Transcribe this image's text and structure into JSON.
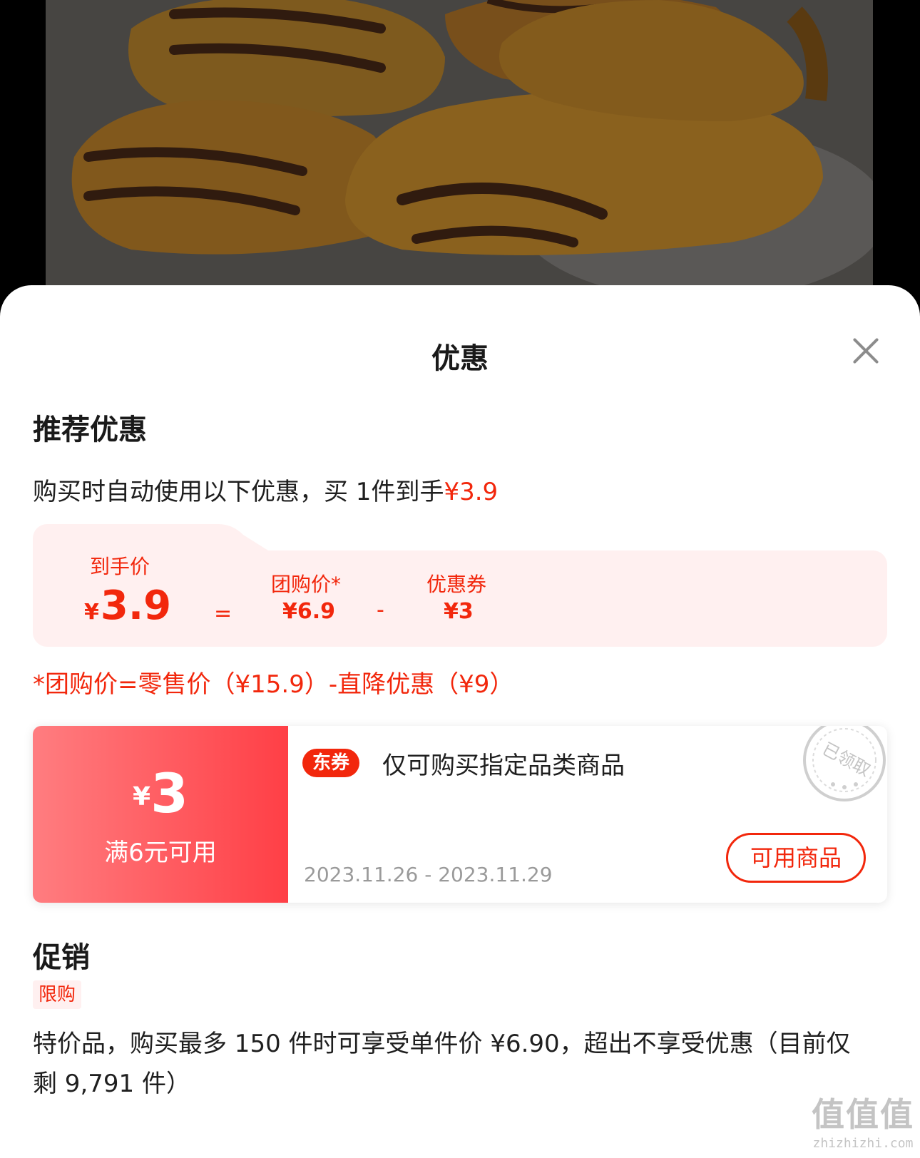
{
  "sheet": {
    "title": "优惠"
  },
  "recommended": {
    "title": "推荐优惠",
    "intro_prefix": "购买时自动使用以下优惠，买 1件到手",
    "intro_price": "¥3.9"
  },
  "breakdown": {
    "final_label": "到手价",
    "final_yen": "¥",
    "final_value": "3.9",
    "equals": "=",
    "group_label": "团购价*",
    "group_value": "¥6.9",
    "minus": "-",
    "coupon_label": "优惠券",
    "coupon_value": "¥3",
    "formula": "*团购价=零售价（¥15.9）-直降优惠（¥9）"
  },
  "coupon": {
    "yen": "¥",
    "amount": "3",
    "condition": "满6元可用",
    "badge": "东券",
    "description": "仅可购买指定品类商品",
    "date_range": "2023.11.26 - 2023.11.29",
    "button_label": "可用商品",
    "stamp_text": "已领取"
  },
  "promotion": {
    "title": "促销",
    "tag": "限购",
    "text": "特价品，购买最多 150 件时可享受单件价 ¥6.90，超出不享受优惠（目前仅剩 9,791 件）"
  },
  "watermark": {
    "main": "值值值",
    "sub": "zhizhizhi.com"
  },
  "colors": {
    "accent": "#f2270c",
    "coupon_gradient_start": "#ff7d80",
    "coupon_gradient_end": "#ff3f46",
    "soft_bg": "#fff0f0"
  }
}
